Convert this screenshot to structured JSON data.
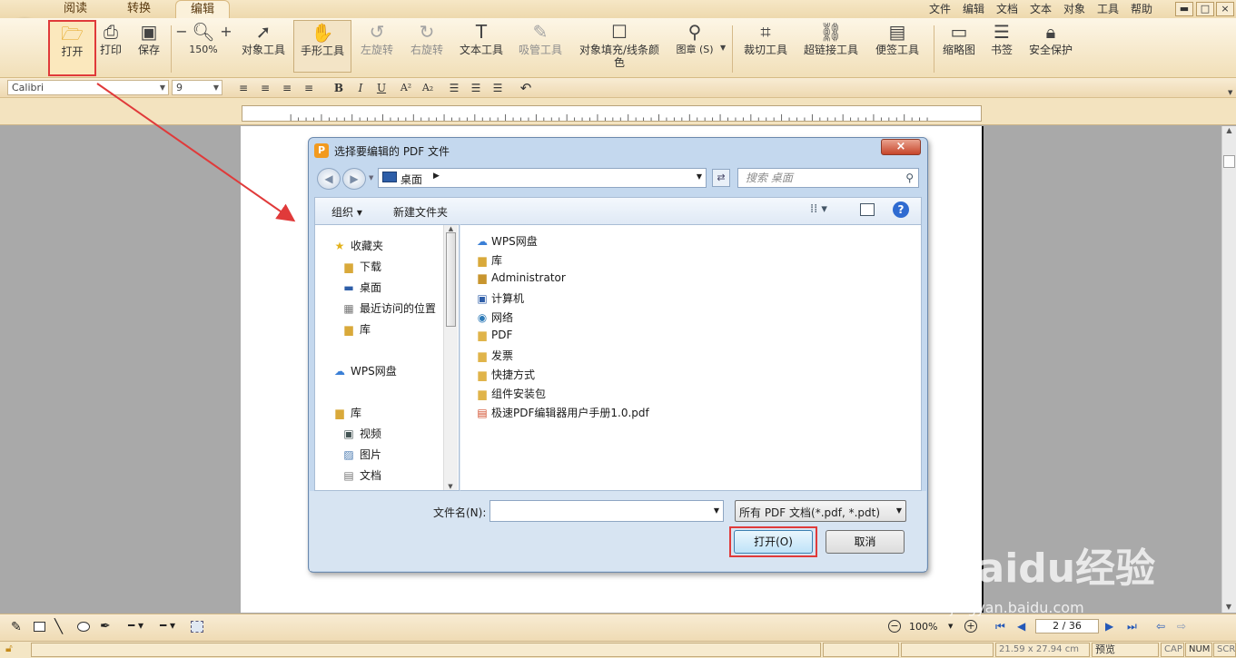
{
  "tabs": [
    "阅读",
    "转换",
    "编辑"
  ],
  "active_tab_index": 2,
  "menu": [
    "文件",
    "编辑",
    "文档",
    "文本",
    "对象",
    "工具",
    "帮助"
  ],
  "window_controls": {
    "minimize": "▬",
    "maximize": "□",
    "close": "×"
  },
  "toolbar": {
    "open": "打开",
    "print": "打印",
    "save": "保存",
    "zoom_out": "−",
    "zoom_in": "+",
    "zoom_value": "150%",
    "object_tool": "对象工具",
    "hand_tool": "手形工具",
    "rotate_left": "左旋转",
    "rotate_right": "右旋转",
    "text_tool": "文本工具",
    "eyedropper": "吸管工具",
    "fill_color_line1": "对象填充/线条颜",
    "fill_color_line2": "色",
    "stamp": "图章 (S)",
    "crop": "裁切工具",
    "hyperlink": "超链接工具",
    "note": "便签工具",
    "thumbnail": "缩略图",
    "bookmark": "书签",
    "security": "安全保护"
  },
  "format": {
    "font": "Calibri",
    "size": "9",
    "bold": "B",
    "italic": "I",
    "underline": "U",
    "superscript": "A²",
    "subscript": "A₂"
  },
  "dialog": {
    "title": "选择要编辑的 PDF 文件",
    "location": "桌面",
    "search_placeholder": "搜索 桌面",
    "organize": "组织 ▾",
    "new_folder": "新建文件夹",
    "nav": {
      "favorites": "收藏夹",
      "downloads": "下载",
      "desktop": "桌面",
      "recent": "最近访问的位置",
      "library1": "库",
      "wps_cloud": "WPS网盘",
      "library2": "库",
      "videos": "视频",
      "pictures": "图片",
      "documents": "文档"
    },
    "files": [
      {
        "name": "WPS网盘",
        "icon": "cloud-icon"
      },
      {
        "name": "库",
        "icon": "library-folder-icon"
      },
      {
        "name": "Administrator",
        "icon": "user-folder-icon"
      },
      {
        "name": "计算机",
        "icon": "computer-icon"
      },
      {
        "name": "网络",
        "icon": "network-icon"
      },
      {
        "name": "PDF",
        "icon": "folder-icon"
      },
      {
        "name": "发票",
        "icon": "folder-icon"
      },
      {
        "name": "快捷方式",
        "icon": "folder-icon"
      },
      {
        "name": "组件安装包",
        "icon": "folder-icon"
      },
      {
        "name": "极速PDF编辑器用户手册1.0.pdf",
        "icon": "pdf-file-icon"
      }
    ],
    "filename_label": "文件名(N):",
    "filename_value": "",
    "filetype": "所有 PDF 文档(*.pdf, *.pdt)",
    "open_button": "打开(O)",
    "cancel_button": "取消"
  },
  "bottom": {
    "zoom": "100%",
    "page": "2 / 36"
  },
  "status": {
    "page_size": "21.59 x 27.94 cm",
    "mode": "预览",
    "cap": "CAP",
    "num": "NUM",
    "scrl": "SCRL"
  },
  "watermark": {
    "brand": "Baidu经验",
    "url": "jingyan.baidu.com"
  },
  "colors": {
    "accent": "#e03a3a",
    "ribbon": "#f1dfb8",
    "dialog_frame": "#c4d8ee"
  }
}
